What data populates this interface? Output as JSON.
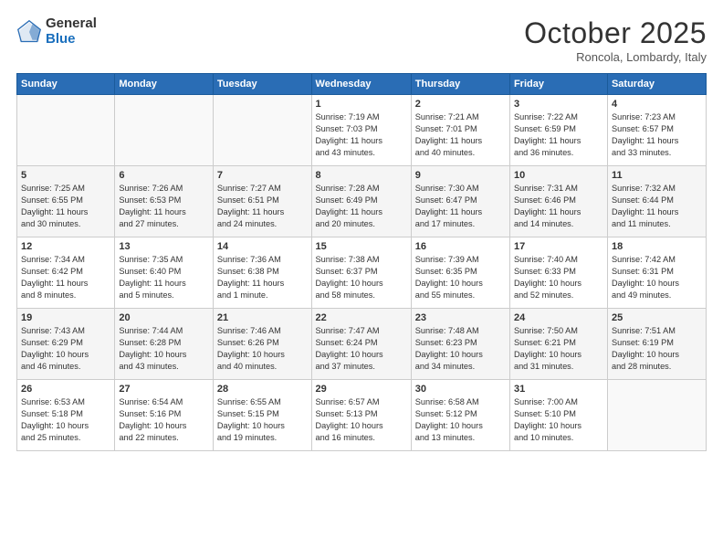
{
  "logo": {
    "general": "General",
    "blue": "Blue"
  },
  "title": "October 2025",
  "subtitle": "Roncola, Lombardy, Italy",
  "weekdays": [
    "Sunday",
    "Monday",
    "Tuesday",
    "Wednesday",
    "Thursday",
    "Friday",
    "Saturday"
  ],
  "weeks": [
    [
      {
        "day": "",
        "info": ""
      },
      {
        "day": "",
        "info": ""
      },
      {
        "day": "",
        "info": ""
      },
      {
        "day": "1",
        "info": "Sunrise: 7:19 AM\nSunset: 7:03 PM\nDaylight: 11 hours\nand 43 minutes."
      },
      {
        "day": "2",
        "info": "Sunrise: 7:21 AM\nSunset: 7:01 PM\nDaylight: 11 hours\nand 40 minutes."
      },
      {
        "day": "3",
        "info": "Sunrise: 7:22 AM\nSunset: 6:59 PM\nDaylight: 11 hours\nand 36 minutes."
      },
      {
        "day": "4",
        "info": "Sunrise: 7:23 AM\nSunset: 6:57 PM\nDaylight: 11 hours\nand 33 minutes."
      }
    ],
    [
      {
        "day": "5",
        "info": "Sunrise: 7:25 AM\nSunset: 6:55 PM\nDaylight: 11 hours\nand 30 minutes."
      },
      {
        "day": "6",
        "info": "Sunrise: 7:26 AM\nSunset: 6:53 PM\nDaylight: 11 hours\nand 27 minutes."
      },
      {
        "day": "7",
        "info": "Sunrise: 7:27 AM\nSunset: 6:51 PM\nDaylight: 11 hours\nand 24 minutes."
      },
      {
        "day": "8",
        "info": "Sunrise: 7:28 AM\nSunset: 6:49 PM\nDaylight: 11 hours\nand 20 minutes."
      },
      {
        "day": "9",
        "info": "Sunrise: 7:30 AM\nSunset: 6:47 PM\nDaylight: 11 hours\nand 17 minutes."
      },
      {
        "day": "10",
        "info": "Sunrise: 7:31 AM\nSunset: 6:46 PM\nDaylight: 11 hours\nand 14 minutes."
      },
      {
        "day": "11",
        "info": "Sunrise: 7:32 AM\nSunset: 6:44 PM\nDaylight: 11 hours\nand 11 minutes."
      }
    ],
    [
      {
        "day": "12",
        "info": "Sunrise: 7:34 AM\nSunset: 6:42 PM\nDaylight: 11 hours\nand 8 minutes."
      },
      {
        "day": "13",
        "info": "Sunrise: 7:35 AM\nSunset: 6:40 PM\nDaylight: 11 hours\nand 5 minutes."
      },
      {
        "day": "14",
        "info": "Sunrise: 7:36 AM\nSunset: 6:38 PM\nDaylight: 11 hours\nand 1 minute."
      },
      {
        "day": "15",
        "info": "Sunrise: 7:38 AM\nSunset: 6:37 PM\nDaylight: 10 hours\nand 58 minutes."
      },
      {
        "day": "16",
        "info": "Sunrise: 7:39 AM\nSunset: 6:35 PM\nDaylight: 10 hours\nand 55 minutes."
      },
      {
        "day": "17",
        "info": "Sunrise: 7:40 AM\nSunset: 6:33 PM\nDaylight: 10 hours\nand 52 minutes."
      },
      {
        "day": "18",
        "info": "Sunrise: 7:42 AM\nSunset: 6:31 PM\nDaylight: 10 hours\nand 49 minutes."
      }
    ],
    [
      {
        "day": "19",
        "info": "Sunrise: 7:43 AM\nSunset: 6:29 PM\nDaylight: 10 hours\nand 46 minutes."
      },
      {
        "day": "20",
        "info": "Sunrise: 7:44 AM\nSunset: 6:28 PM\nDaylight: 10 hours\nand 43 minutes."
      },
      {
        "day": "21",
        "info": "Sunrise: 7:46 AM\nSunset: 6:26 PM\nDaylight: 10 hours\nand 40 minutes."
      },
      {
        "day": "22",
        "info": "Sunrise: 7:47 AM\nSunset: 6:24 PM\nDaylight: 10 hours\nand 37 minutes."
      },
      {
        "day": "23",
        "info": "Sunrise: 7:48 AM\nSunset: 6:23 PM\nDaylight: 10 hours\nand 34 minutes."
      },
      {
        "day": "24",
        "info": "Sunrise: 7:50 AM\nSunset: 6:21 PM\nDaylight: 10 hours\nand 31 minutes."
      },
      {
        "day": "25",
        "info": "Sunrise: 7:51 AM\nSunset: 6:19 PM\nDaylight: 10 hours\nand 28 minutes."
      }
    ],
    [
      {
        "day": "26",
        "info": "Sunrise: 6:53 AM\nSunset: 5:18 PM\nDaylight: 10 hours\nand 25 minutes."
      },
      {
        "day": "27",
        "info": "Sunrise: 6:54 AM\nSunset: 5:16 PM\nDaylight: 10 hours\nand 22 minutes."
      },
      {
        "day": "28",
        "info": "Sunrise: 6:55 AM\nSunset: 5:15 PM\nDaylight: 10 hours\nand 19 minutes."
      },
      {
        "day": "29",
        "info": "Sunrise: 6:57 AM\nSunset: 5:13 PM\nDaylight: 10 hours\nand 16 minutes."
      },
      {
        "day": "30",
        "info": "Sunrise: 6:58 AM\nSunset: 5:12 PM\nDaylight: 10 hours\nand 13 minutes."
      },
      {
        "day": "31",
        "info": "Sunrise: 7:00 AM\nSunset: 5:10 PM\nDaylight: 10 hours\nand 10 minutes."
      },
      {
        "day": "",
        "info": ""
      }
    ]
  ]
}
